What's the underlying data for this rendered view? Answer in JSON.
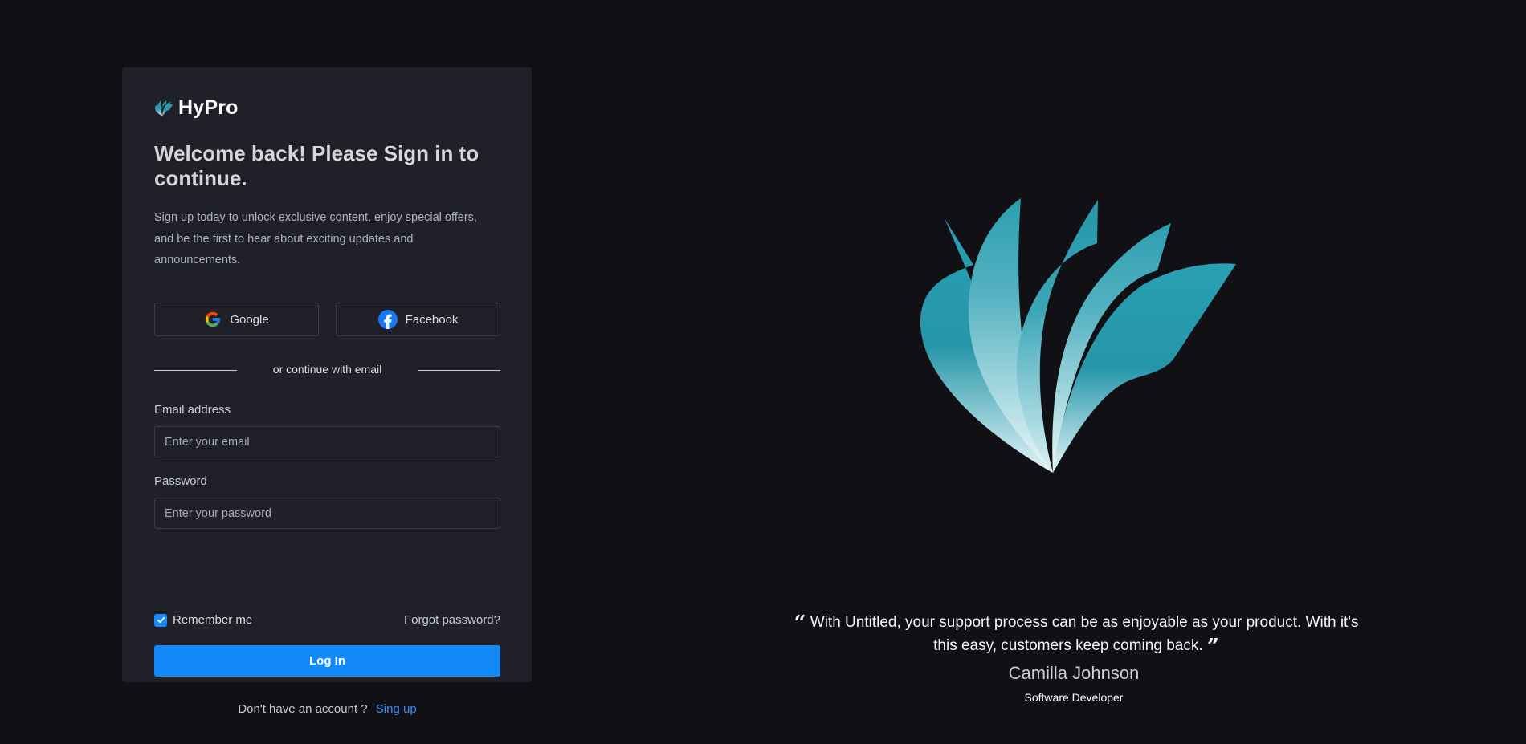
{
  "brand": {
    "name": "HyPro",
    "logo_icon": "lotus-logo-icon",
    "accent": "#2ea3b5"
  },
  "login": {
    "headline": "Welcome back! Please Sign in to continue.",
    "subtext": "Sign up today to unlock exclusive content, enjoy special offers, and be the first to hear about exciting updates and announcements.",
    "social": {
      "google_label": "Google",
      "google_icon": "google-icon",
      "facebook_label": "Facebook",
      "facebook_icon": "facebook-icon"
    },
    "divider_text": "or continue with email",
    "email": {
      "label": "Email address",
      "placeholder": "Enter your email",
      "value": ""
    },
    "password": {
      "label": "Password",
      "placeholder": "Enter your password",
      "value": ""
    },
    "remember_me": {
      "label": "Remember me",
      "checked": true
    },
    "forgot_label": "Forgot password?",
    "login_button": "Log In",
    "no_account_text": "Don't have an account ?",
    "signup_link": "Sing up",
    "primary_color": "#1389f8"
  },
  "testimonial": {
    "quote": "With Untitled, your support process can be as enjoyable as your product. With it's this easy, customers keep coming back.",
    "open_mark": "“",
    "close_mark": "”",
    "author": "Camilla Johnson",
    "role": "Software Developer"
  }
}
